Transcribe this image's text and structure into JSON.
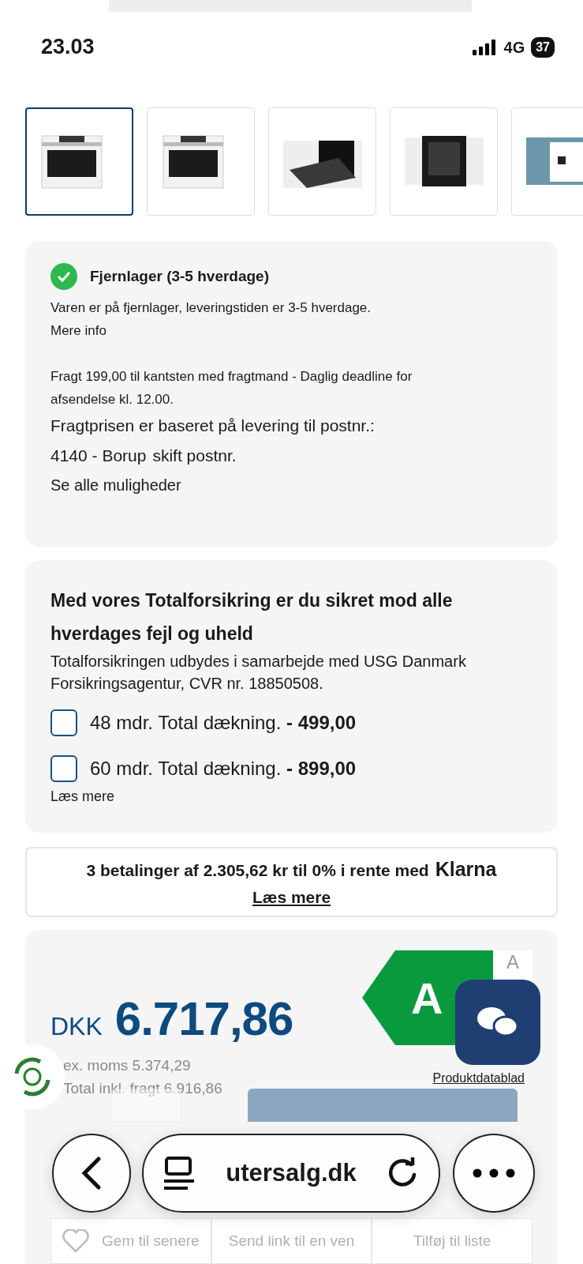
{
  "status_bar": {
    "time": "23.03",
    "network": "4G",
    "battery": "37"
  },
  "thumbnails": [
    {
      "kind": "oven-front",
      "selected": true
    },
    {
      "kind": "oven-front",
      "selected": false
    },
    {
      "kind": "oven-door-open",
      "selected": false
    },
    {
      "kind": "oven-interior",
      "selected": false
    },
    {
      "kind": "kitchen",
      "selected": false
    }
  ],
  "stock": {
    "title": "Fjernlager (3-5 hverdage)",
    "description": "Varen er på fjernlager, leveringstiden er 3-5 hverdage.",
    "more_info": "Mere info",
    "freight": "Fragt 199,00 til kantsten med fragtmand - Daglig deadline for afsendelse kl. 12.00.",
    "postcode_line": "Fragtprisen er baseret på levering til postnr.:",
    "postcode": "4140 - Borup",
    "change_postcode": "skift postnr.",
    "all_options": "Se alle muligheder"
  },
  "insurance": {
    "title": "Med vores Totalforsikring er du sikret mod alle hverdages fejl og uheld",
    "description": "Totalforsikringen udbydes i samarbejde med USG Danmark Forsikringsagentur, CVR nr. 18850508.",
    "options": [
      {
        "label": "48 mdr. Total dækning.",
        "price": "- 499,00",
        "checked": false
      },
      {
        "label": "60 mdr. Total dækning.",
        "price": "- 899,00",
        "checked": false
      }
    ],
    "read_more": "Læs mere"
  },
  "klarna": {
    "text": "3 betalinger af 2.305,62 kr til 0% i rente med",
    "brand": "Klarna",
    "link": "Læs mere"
  },
  "price": {
    "currency": "DKK",
    "amount": "6.717,86",
    "ex_vat": "ex. moms 5.374,29",
    "total": "Total inkl. fragt 6.916,86",
    "energy_class": "A",
    "energy_scale": "A",
    "datasheet": "Produktdatablad"
  },
  "actions": [
    {
      "kind": "save",
      "label": "Gem til senere"
    },
    {
      "kind": "send",
      "label": "Send link til en ven"
    },
    {
      "kind": "list",
      "label": "Tilføj til liste"
    }
  ],
  "browser": {
    "url": "utersalg.dk"
  }
}
